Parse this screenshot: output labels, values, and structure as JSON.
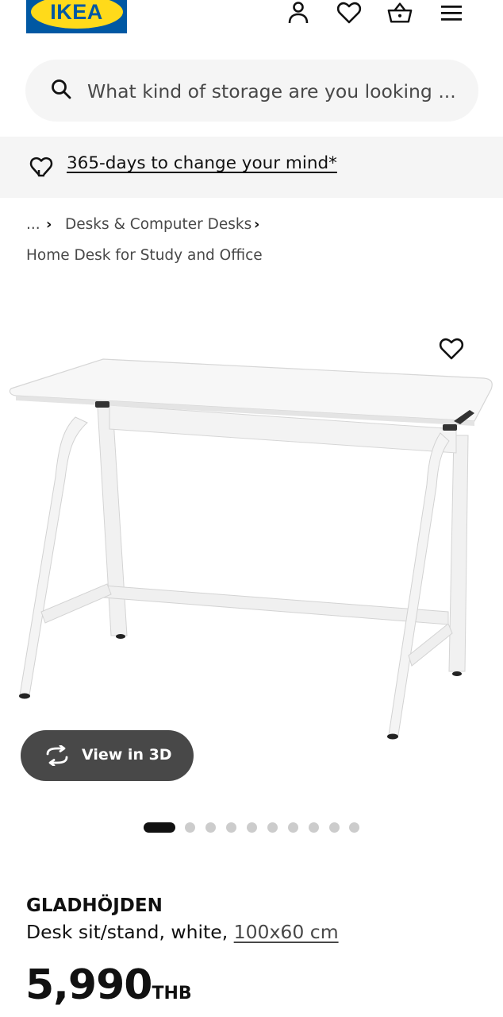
{
  "header": {
    "logo_text": "IKEA",
    "icons": [
      "account-icon",
      "wishlist-heart-icon",
      "shopping-basket-icon",
      "menu-hamburger-icon"
    ]
  },
  "search": {
    "placeholder": "What kind of storage are you looking ..."
  },
  "promo": {
    "text": "365-days to change your mind*"
  },
  "breadcrumb": {
    "ellipsis": "...",
    "category": "Desks & Computer Desks",
    "current": "Home Desk for Study and Office"
  },
  "gallery": {
    "view_3d_label": "View in 3D",
    "slide_count": 10,
    "active_slide": 1
  },
  "product": {
    "name": "GLADHÖJDEN",
    "description": "Desk sit/stand, white, ",
    "size": "100x60 cm",
    "price": "5,990",
    "currency": "THB"
  },
  "colors": {
    "ikea_blue": "#0058a3",
    "ikea_yellow": "#ffda1a",
    "button_dark": "#484848",
    "grey_bg": "#f5f5f5"
  }
}
